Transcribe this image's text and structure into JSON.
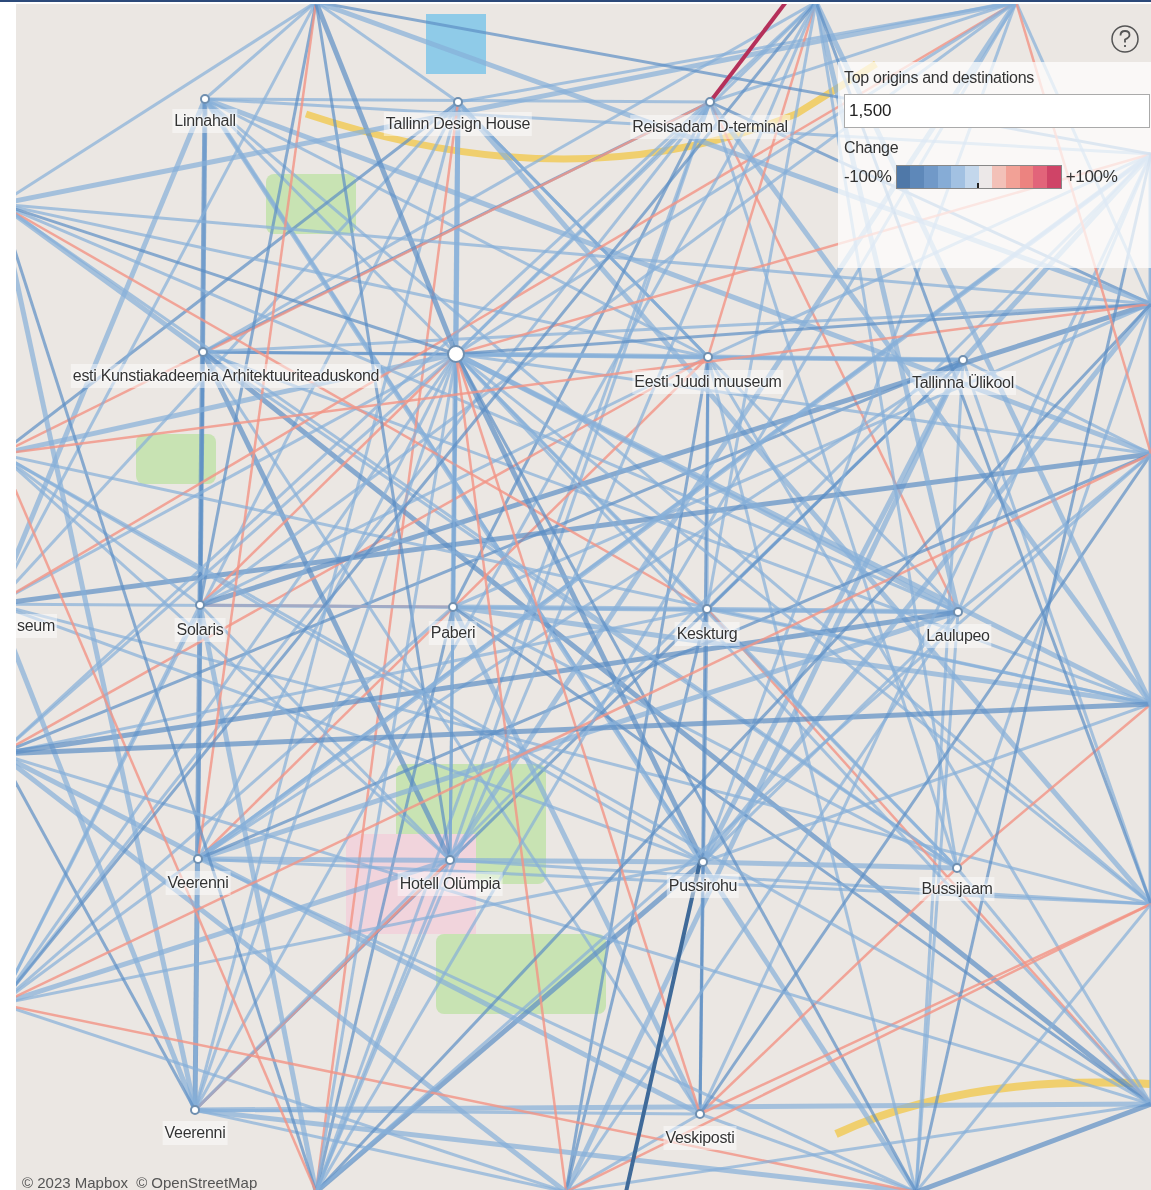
{
  "map": {
    "nodes": [
      {
        "label": "Linnahall"
      },
      {
        "label": "Tallinn Design House"
      },
      {
        "label": "Reisisadam D-terminal"
      },
      {
        "label": "esti Kunstiakadeemia Arhitektuuriteaduskond"
      },
      {
        "label": "Eesti Juudi muuseum"
      },
      {
        "label": "Tallinna Ülikool"
      },
      {
        "label": "seum"
      },
      {
        "label": "Solaris"
      },
      {
        "label": "Paberi"
      },
      {
        "label": "Keskturg"
      },
      {
        "label": "Laulupeo"
      },
      {
        "label": "Veerenni"
      },
      {
        "label": "Hotell Olümpia"
      },
      {
        "label": "Pussirohu"
      },
      {
        "label": "Bussijaam"
      },
      {
        "label": "Veerenni"
      },
      {
        "label": "Veskiposti"
      }
    ],
    "attribution": [
      "© 2023 Mapbox",
      "© OpenStreetMap"
    ]
  },
  "controls": {
    "top_n": {
      "label": "Top origins and destinations",
      "value": "1,500"
    },
    "legend": {
      "title": "Change",
      "min_label": "-100%",
      "max_label": "+100%"
    }
  }
}
